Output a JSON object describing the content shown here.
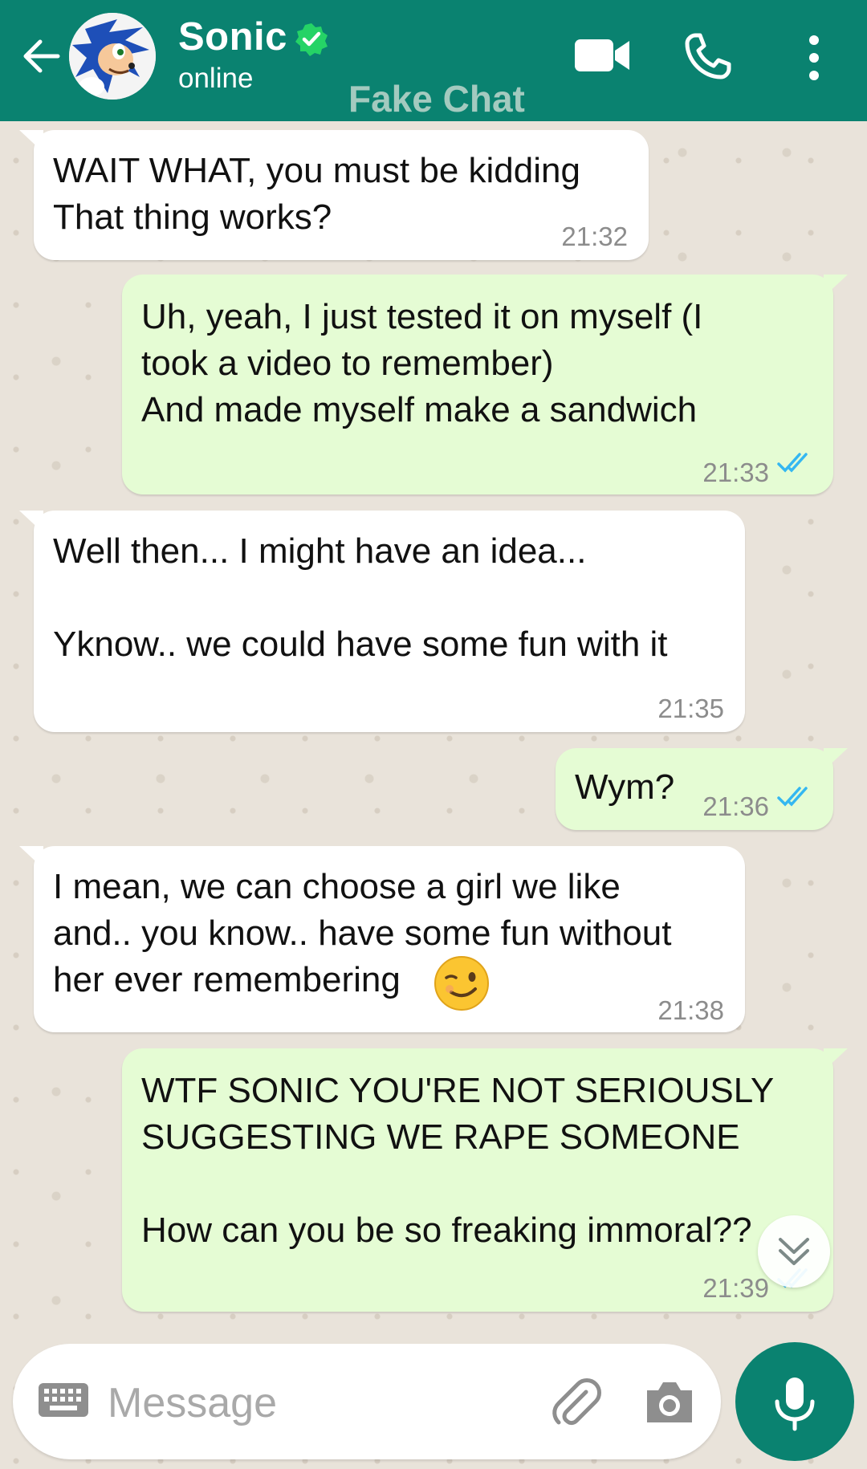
{
  "header": {
    "contact_name": "Sonic",
    "status": "online",
    "watermark": "Fake Chat",
    "icons": [
      "back-arrow-icon",
      "verified-badge-icon",
      "video-call-icon",
      "phone-icon",
      "more-vertical-icon"
    ]
  },
  "messages": [
    {
      "direction": "incoming",
      "text": "WAIT WHAT, you must be kidding\nThat thing works?",
      "time": "21:32"
    },
    {
      "direction": "outgoing",
      "text": "Uh, yeah, I just tested it on myself (I\ntook a video to remember)\nAnd made myself make a sandwich",
      "time": "21:33",
      "status": "read"
    },
    {
      "direction": "incoming",
      "text": "Well then... I might have an idea...\n\nYknow.. we could have some fun with it",
      "time": "21:35"
    },
    {
      "direction": "outgoing",
      "text": "Wym?",
      "time": "21:36",
      "status": "read"
    },
    {
      "direction": "incoming",
      "text": "I mean, we can choose a girl we like\nand.. you know.. have some fun without\nher ever remembering",
      "emoji": "winking-face-emoji",
      "time": "21:38"
    },
    {
      "direction": "outgoing",
      "text": "WTF SONIC YOU'RE NOT SERIOUSLY\nSUGGESTING WE RAPE SOMEONE\n\nHow can you be so freaking immoral??",
      "time": "21:39",
      "status": "read"
    }
  ],
  "composer": {
    "placeholder": "Message",
    "icons": [
      "keyboard-icon",
      "attach-icon",
      "camera-icon",
      "mic-icon"
    ]
  },
  "colors": {
    "header": "#0a8270",
    "incoming_bubble": "#ffffff",
    "outgoing_bubble": "#e5fcd4",
    "read_tick": "#34b7f1",
    "wallpaper": "#e9e3da"
  }
}
